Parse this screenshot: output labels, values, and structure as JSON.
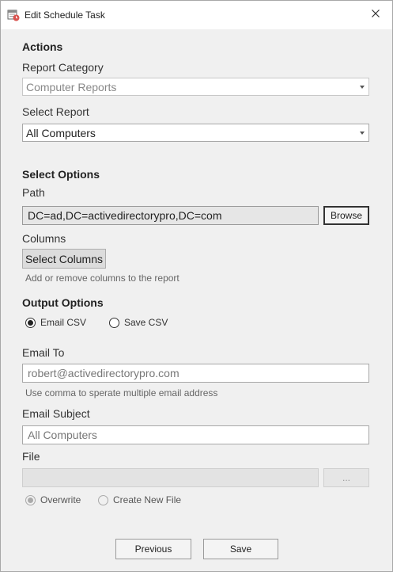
{
  "window": {
    "title": "Edit Schedule Task"
  },
  "actions": {
    "heading": "Actions",
    "report_category_label": "Report Category",
    "report_category_value": "Computer Reports",
    "select_report_label": "Select Report",
    "select_report_value": "All Computers"
  },
  "select_options": {
    "heading": "Select Options",
    "path_label": "Path",
    "path_value": "DC=ad,DC=activedirectorypro,DC=com",
    "browse_label": "Browse",
    "columns_label": "Columns",
    "select_columns_label": "Select Columns",
    "columns_hint": "Add or remove columns to the report"
  },
  "output_options": {
    "heading": "Output Options",
    "email_csv_label": "Email CSV",
    "save_csv_label": "Save CSV",
    "selected": "Email CSV",
    "email_to_label": "Email To",
    "email_to_value": "robert@activedirectorypro.com",
    "email_hint": "Use comma to sperate multiple email address",
    "email_subject_label": "Email Subject",
    "email_subject_value": "All Computers",
    "file_label": "File",
    "file_value": "",
    "file_browse_label": "...",
    "overwrite_label": "Overwrite",
    "create_new_file_label": "Create New File",
    "file_mode_selected": "Overwrite"
  },
  "footer": {
    "previous_label": "Previous",
    "save_label": "Save"
  }
}
